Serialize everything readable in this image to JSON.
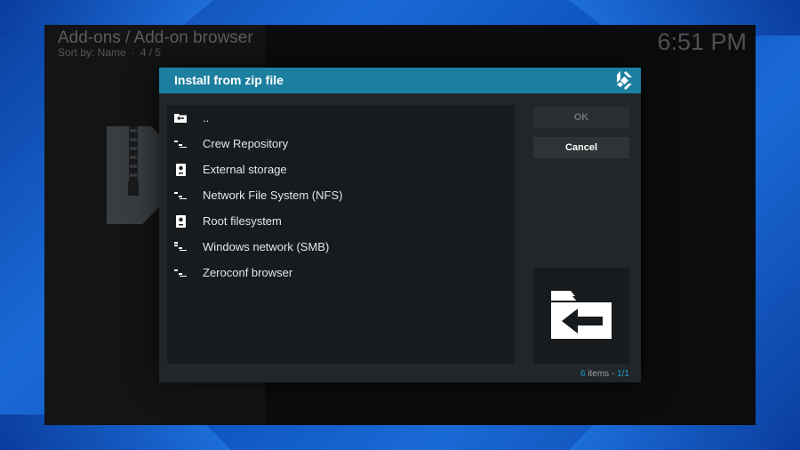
{
  "header": {
    "title": "Add-ons / Add-on browser",
    "sort_label": "Sort by: Name",
    "position": "4 / 5",
    "clock": "6:51 PM"
  },
  "dialog": {
    "title": "Install from zip file",
    "ok_label": "OK",
    "cancel_label": "Cancel",
    "items": [
      {
        "label": "..",
        "icon": "folder-back-icon"
      },
      {
        "label": "Crew Repository",
        "icon": "network-share-icon"
      },
      {
        "label": "External storage",
        "icon": "drive-icon"
      },
      {
        "label": "Network File System (NFS)",
        "icon": "network-share-icon"
      },
      {
        "label": "Root filesystem",
        "icon": "drive-icon"
      },
      {
        "label": "Windows network (SMB)",
        "icon": "network-share-icon"
      },
      {
        "label": "Zeroconf browser",
        "icon": "network-share-icon"
      }
    ],
    "count_number": "6",
    "count_word": "items",
    "count_sep": "-",
    "page": "1/1"
  },
  "colors": {
    "header_bar": "#1c7fa0",
    "accent": "#1f9bd1",
    "dialog_bg": "#222628",
    "list_bg": "#181b1d"
  }
}
